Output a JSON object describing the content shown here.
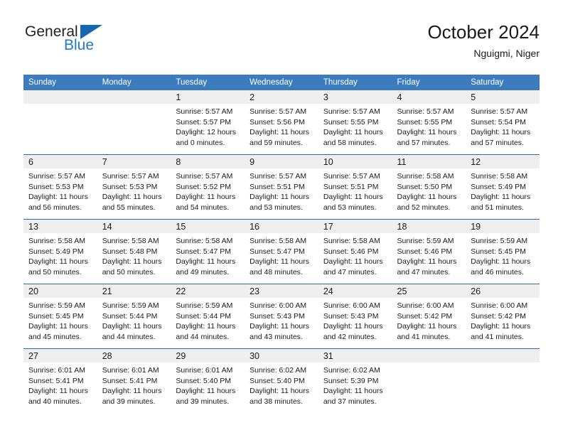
{
  "brand": {
    "name_top": "General",
    "name_bottom": "Blue",
    "accent_color": "#1268b3",
    "text_color": "#231f20"
  },
  "header": {
    "title": "October 2024",
    "subtitle": "Nguigmi, Niger"
  },
  "calendar": {
    "header_bg": "#3c7cbe",
    "header_text_color": "#ffffff",
    "row_separator_color": "#2e6cad",
    "daynum_band_color": "#efefef",
    "weekday_headers": [
      "Sunday",
      "Monday",
      "Tuesday",
      "Wednesday",
      "Thursday",
      "Friday",
      "Saturday"
    ],
    "weeks": [
      [
        {
          "day": "",
          "lines": []
        },
        {
          "day": "",
          "lines": []
        },
        {
          "day": "1",
          "lines": [
            "Sunrise: 5:57 AM",
            "Sunset: 5:57 PM",
            "Daylight: 12 hours",
            "and 0 minutes."
          ]
        },
        {
          "day": "2",
          "lines": [
            "Sunrise: 5:57 AM",
            "Sunset: 5:56 PM",
            "Daylight: 11 hours",
            "and 59 minutes."
          ]
        },
        {
          "day": "3",
          "lines": [
            "Sunrise: 5:57 AM",
            "Sunset: 5:55 PM",
            "Daylight: 11 hours",
            "and 58 minutes."
          ]
        },
        {
          "day": "4",
          "lines": [
            "Sunrise: 5:57 AM",
            "Sunset: 5:55 PM",
            "Daylight: 11 hours",
            "and 57 minutes."
          ]
        },
        {
          "day": "5",
          "lines": [
            "Sunrise: 5:57 AM",
            "Sunset: 5:54 PM",
            "Daylight: 11 hours",
            "and 57 minutes."
          ]
        }
      ],
      [
        {
          "day": "6",
          "lines": [
            "Sunrise: 5:57 AM",
            "Sunset: 5:53 PM",
            "Daylight: 11 hours",
            "and 56 minutes."
          ]
        },
        {
          "day": "7",
          "lines": [
            "Sunrise: 5:57 AM",
            "Sunset: 5:53 PM",
            "Daylight: 11 hours",
            "and 55 minutes."
          ]
        },
        {
          "day": "8",
          "lines": [
            "Sunrise: 5:57 AM",
            "Sunset: 5:52 PM",
            "Daylight: 11 hours",
            "and 54 minutes."
          ]
        },
        {
          "day": "9",
          "lines": [
            "Sunrise: 5:57 AM",
            "Sunset: 5:51 PM",
            "Daylight: 11 hours",
            "and 53 minutes."
          ]
        },
        {
          "day": "10",
          "lines": [
            "Sunrise: 5:57 AM",
            "Sunset: 5:51 PM",
            "Daylight: 11 hours",
            "and 53 minutes."
          ]
        },
        {
          "day": "11",
          "lines": [
            "Sunrise: 5:58 AM",
            "Sunset: 5:50 PM",
            "Daylight: 11 hours",
            "and 52 minutes."
          ]
        },
        {
          "day": "12",
          "lines": [
            "Sunrise: 5:58 AM",
            "Sunset: 5:49 PM",
            "Daylight: 11 hours",
            "and 51 minutes."
          ]
        }
      ],
      [
        {
          "day": "13",
          "lines": [
            "Sunrise: 5:58 AM",
            "Sunset: 5:49 PM",
            "Daylight: 11 hours",
            "and 50 minutes."
          ]
        },
        {
          "day": "14",
          "lines": [
            "Sunrise: 5:58 AM",
            "Sunset: 5:48 PM",
            "Daylight: 11 hours",
            "and 50 minutes."
          ]
        },
        {
          "day": "15",
          "lines": [
            "Sunrise: 5:58 AM",
            "Sunset: 5:47 PM",
            "Daylight: 11 hours",
            "and 49 minutes."
          ]
        },
        {
          "day": "16",
          "lines": [
            "Sunrise: 5:58 AM",
            "Sunset: 5:47 PM",
            "Daylight: 11 hours",
            "and 48 minutes."
          ]
        },
        {
          "day": "17",
          "lines": [
            "Sunrise: 5:58 AM",
            "Sunset: 5:46 PM",
            "Daylight: 11 hours",
            "and 47 minutes."
          ]
        },
        {
          "day": "18",
          "lines": [
            "Sunrise: 5:59 AM",
            "Sunset: 5:46 PM",
            "Daylight: 11 hours",
            "and 47 minutes."
          ]
        },
        {
          "day": "19",
          "lines": [
            "Sunrise: 5:59 AM",
            "Sunset: 5:45 PM",
            "Daylight: 11 hours",
            "and 46 minutes."
          ]
        }
      ],
      [
        {
          "day": "20",
          "lines": [
            "Sunrise: 5:59 AM",
            "Sunset: 5:45 PM",
            "Daylight: 11 hours",
            "and 45 minutes."
          ]
        },
        {
          "day": "21",
          "lines": [
            "Sunrise: 5:59 AM",
            "Sunset: 5:44 PM",
            "Daylight: 11 hours",
            "and 44 minutes."
          ]
        },
        {
          "day": "22",
          "lines": [
            "Sunrise: 5:59 AM",
            "Sunset: 5:44 PM",
            "Daylight: 11 hours",
            "and 44 minutes."
          ]
        },
        {
          "day": "23",
          "lines": [
            "Sunrise: 6:00 AM",
            "Sunset: 5:43 PM",
            "Daylight: 11 hours",
            "and 43 minutes."
          ]
        },
        {
          "day": "24",
          "lines": [
            "Sunrise: 6:00 AM",
            "Sunset: 5:43 PM",
            "Daylight: 11 hours",
            "and 42 minutes."
          ]
        },
        {
          "day": "25",
          "lines": [
            "Sunrise: 6:00 AM",
            "Sunset: 5:42 PM",
            "Daylight: 11 hours",
            "and 41 minutes."
          ]
        },
        {
          "day": "26",
          "lines": [
            "Sunrise: 6:00 AM",
            "Sunset: 5:42 PM",
            "Daylight: 11 hours",
            "and 41 minutes."
          ]
        }
      ],
      [
        {
          "day": "27",
          "lines": [
            "Sunrise: 6:01 AM",
            "Sunset: 5:41 PM",
            "Daylight: 11 hours",
            "and 40 minutes."
          ]
        },
        {
          "day": "28",
          "lines": [
            "Sunrise: 6:01 AM",
            "Sunset: 5:41 PM",
            "Daylight: 11 hours",
            "and 39 minutes."
          ]
        },
        {
          "day": "29",
          "lines": [
            "Sunrise: 6:01 AM",
            "Sunset: 5:40 PM",
            "Daylight: 11 hours",
            "and 39 minutes."
          ]
        },
        {
          "day": "30",
          "lines": [
            "Sunrise: 6:02 AM",
            "Sunset: 5:40 PM",
            "Daylight: 11 hours",
            "and 38 minutes."
          ]
        },
        {
          "day": "31",
          "lines": [
            "Sunrise: 6:02 AM",
            "Sunset: 5:39 PM",
            "Daylight: 11 hours",
            "and 37 minutes."
          ]
        },
        {
          "day": "",
          "lines": []
        },
        {
          "day": "",
          "lines": []
        }
      ]
    ]
  }
}
